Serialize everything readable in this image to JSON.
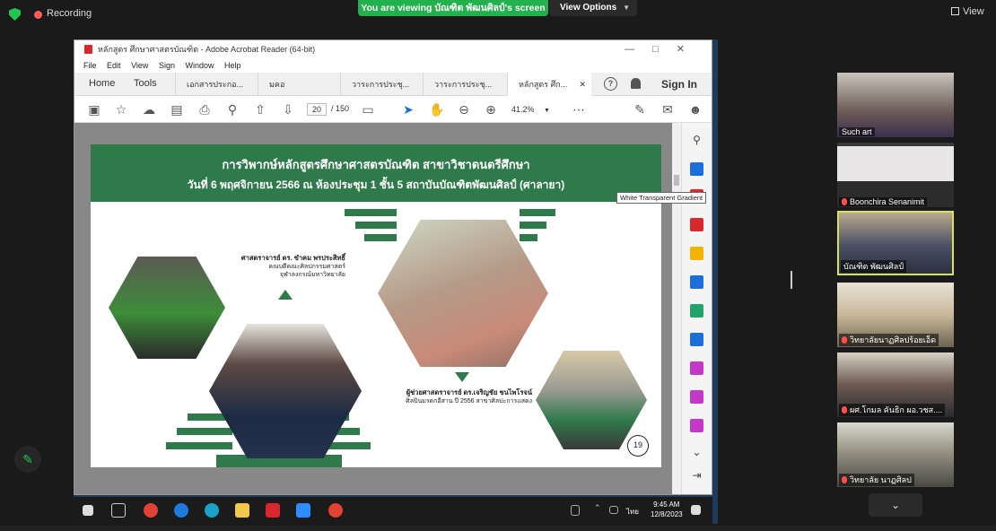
{
  "zoom": {
    "recording_label": "Recording",
    "viewing_banner": "You are viewing บัณฑิต พัฒนศิลป์'s screen",
    "view_options_label": "View Options",
    "view_label": "View"
  },
  "acrobat": {
    "title": "หลักสูตร ศึกษาศาสตรบัณฑิต - Adobe Acrobat Reader (64-bit)",
    "menu": [
      "File",
      "Edit",
      "View",
      "Sign",
      "Window",
      "Help"
    ],
    "home_tab": "Home",
    "tools_tab": "Tools",
    "doc_tabs": [
      "เอกสารประกอ...",
      "มคอ",
      "วาระการประชุ...",
      "วาระการประชุ...",
      "หลักสูตร ศึก..."
    ],
    "sign_in": "Sign In",
    "current_page": "20",
    "total_pages": "/ 150",
    "zoom_level": "41.2%",
    "tooltip": "White Transparent Gradient"
  },
  "slide": {
    "title": "การวิพากษ์หลักสูตรศึกษาศาสตรบัณฑิต สาขาวิชาดนตรีศึกษา",
    "subtitle": "วันที่ 6 พฤศจิกายน 2566 ณ ห้องประชุม 1 ชั้น 5 สถาบันบัณฑิตพัฒนศิลป์ (ศาลายา)",
    "speaker1_name": "ศาสตราจารย์ ดร. ขำคม พรประสิทธิ์",
    "speaker1_line2": "คณบดีคณะศิลปกรรมศาสตร์",
    "speaker1_line3": "จุฬาลงกรณ์มหาวิทยาลัย",
    "speaker2_name": "ผู้ช่วยศาสตราจารย์ ดร.เจริญชัย ชนไพโรจน์",
    "speaker2_line2": "ศิลปินมรดกอีสาน ปี 2556 สาขาศิลปะการแสดง",
    "page_number": "19"
  },
  "taskbar": {
    "time": "9:45 AM",
    "date": "12/8/2023",
    "lang": "ไทย"
  },
  "participants": [
    {
      "name": "Such art",
      "muted": false
    },
    {
      "name": "Boonchira Senanimit",
      "muted": true
    },
    {
      "name": "บัณฑิต พัฒนศิลป์",
      "muted": false
    },
    {
      "name": "วิทยาลัยนาฏศิลปร้อยเอ็ด",
      "muted": true
    },
    {
      "name": "ผศ.โกมล คันธิก ผอ.วชส....",
      "muted": true
    },
    {
      "name": "วิทยาลัย นาฏศิลป",
      "muted": true
    }
  ],
  "colors": {
    "zoom_green": "#23b14d",
    "slide_green": "#2f7a4a",
    "active_speaker": "#d9e24f"
  }
}
